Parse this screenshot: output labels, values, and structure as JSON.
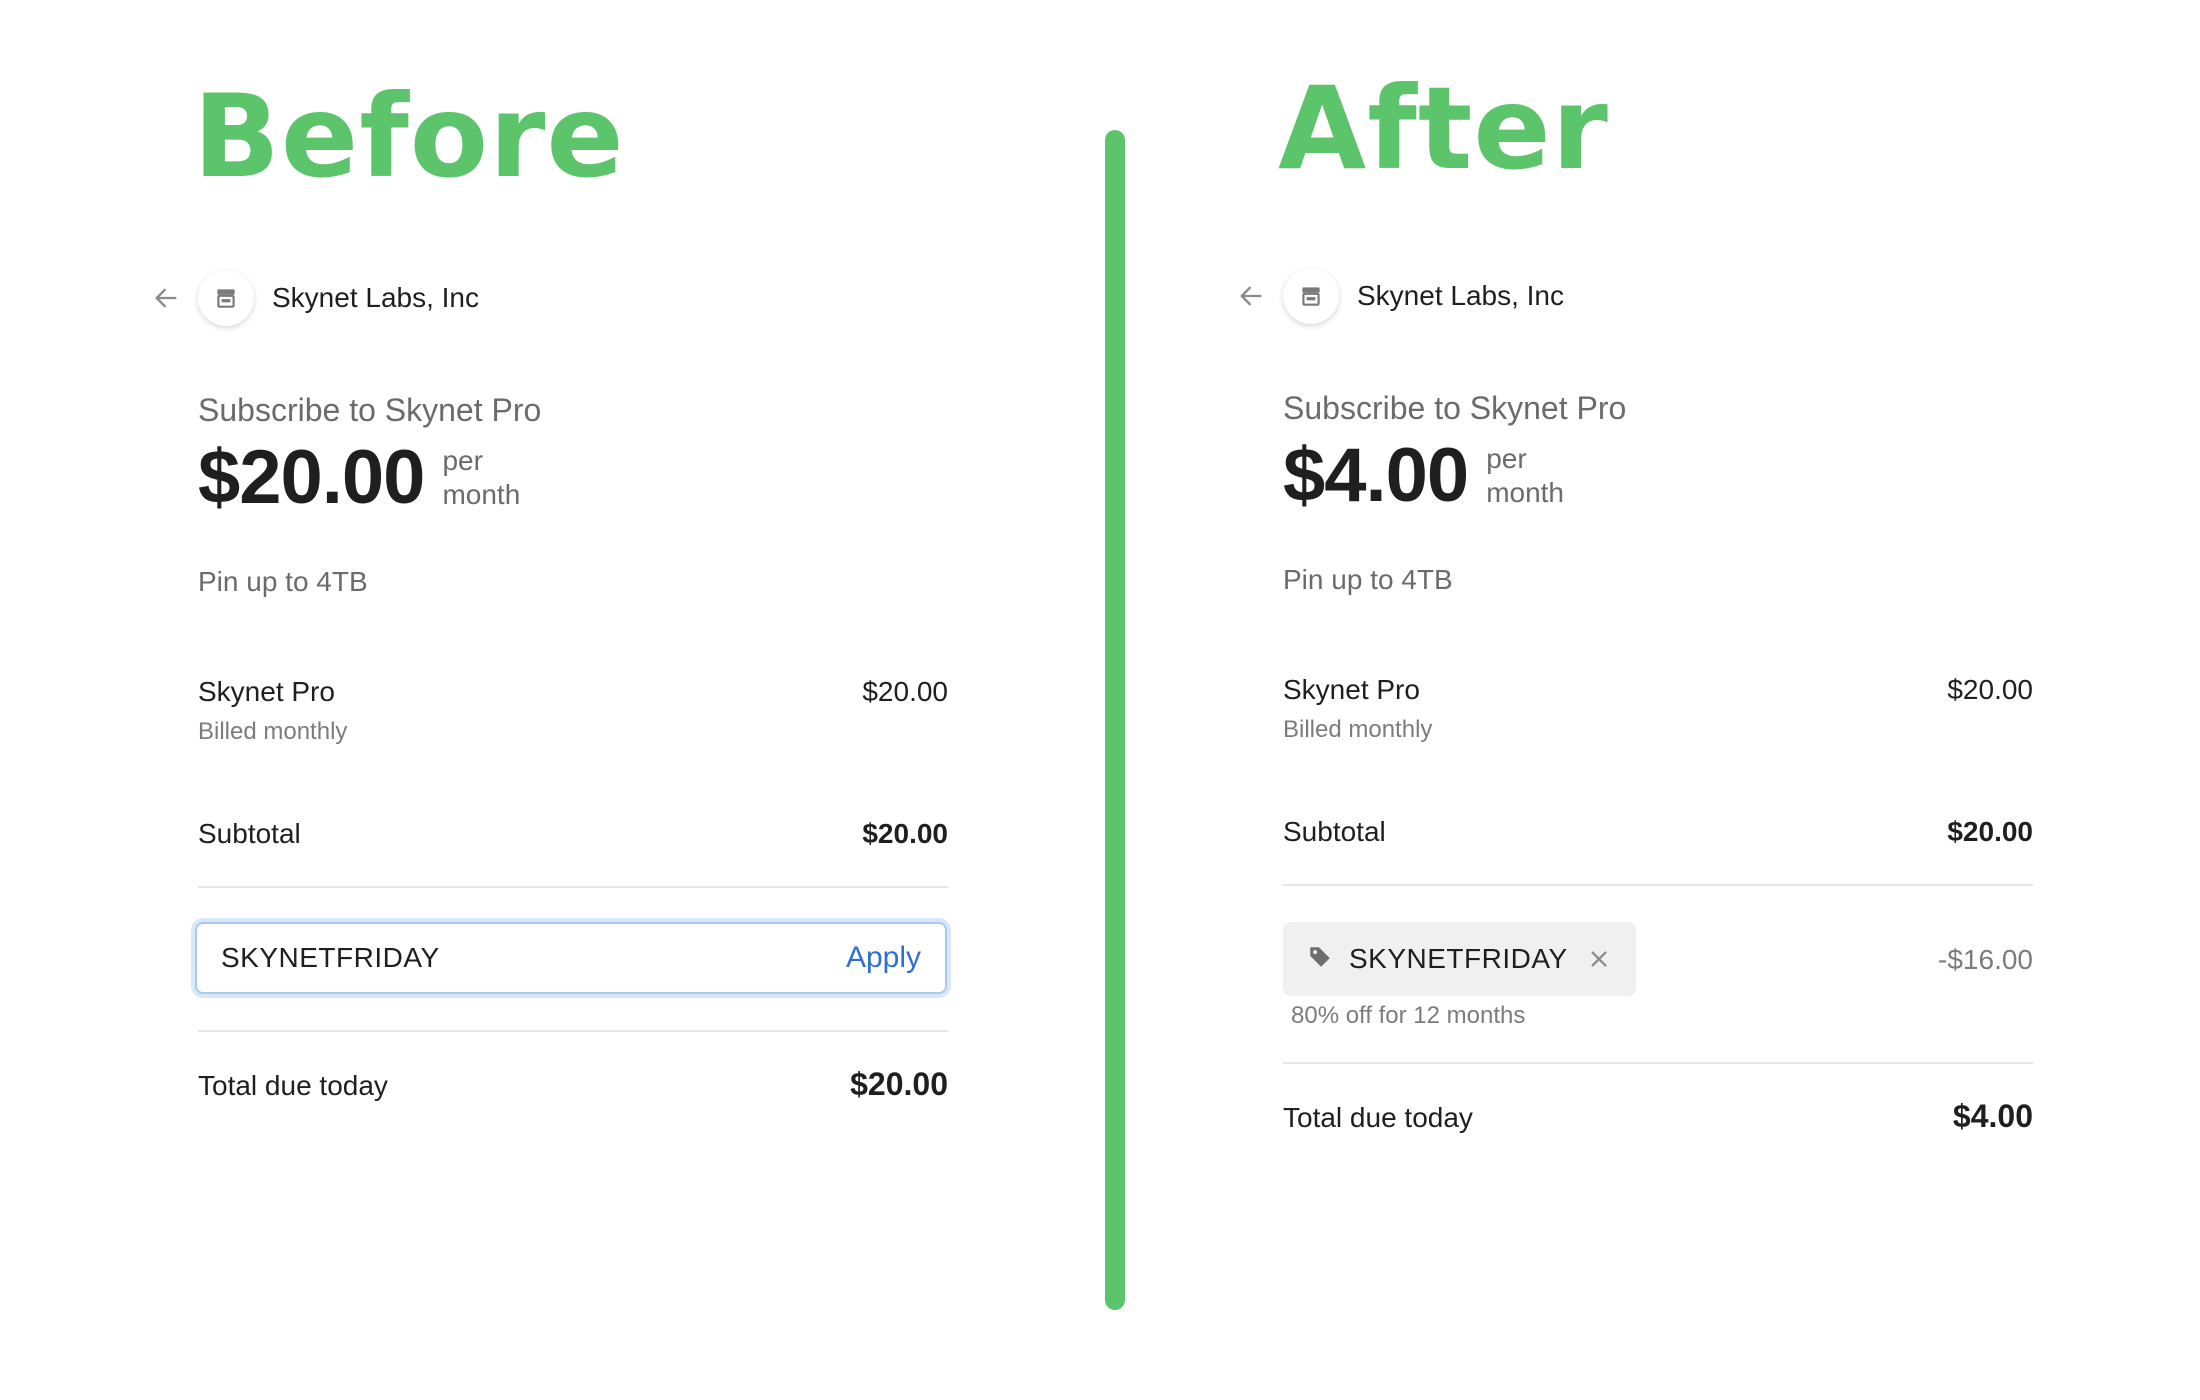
{
  "colors": {
    "heading": "#5cc46a",
    "divider": "#5cc46a",
    "apply": "#2e6fd1",
    "input_focus": "#a9c9ee"
  },
  "before": {
    "heading": "Before",
    "merchant": "Skynet Labs, Inc",
    "subscribe_label": "Subscribe to Skynet Pro",
    "price": "$20.00",
    "period_line1": "per",
    "period_line2": "month",
    "feature": "Pin up to 4TB",
    "item_name": "Skynet Pro",
    "item_billing": "Billed monthly",
    "item_amount": "$20.00",
    "subtotal_label": "Subtotal",
    "subtotal_amount": "$20.00",
    "promo_input_value": "SKYNETFRIDAY",
    "apply_label": "Apply",
    "total_label": "Total due today",
    "total_amount": "$20.00"
  },
  "after": {
    "heading": "After",
    "merchant": "Skynet Labs, Inc",
    "subscribe_label": "Subscribe to Skynet Pro",
    "price": "$4.00",
    "period_line1": "per",
    "period_line2": "month",
    "feature": "Pin up to 4TB",
    "item_name": "Skynet Pro",
    "item_billing": "Billed monthly",
    "item_amount": "$20.00",
    "subtotal_label": "Subtotal",
    "subtotal_amount": "$20.00",
    "promo_code": "SKYNETFRIDAY",
    "promo_description": "80% off for 12 months",
    "discount_amount": "-$16.00",
    "total_label": "Total due today",
    "total_amount": "$4.00"
  },
  "icons": {
    "back": "arrow-left-icon",
    "store": "store-icon",
    "tag": "tag-icon",
    "remove": "close-icon"
  }
}
